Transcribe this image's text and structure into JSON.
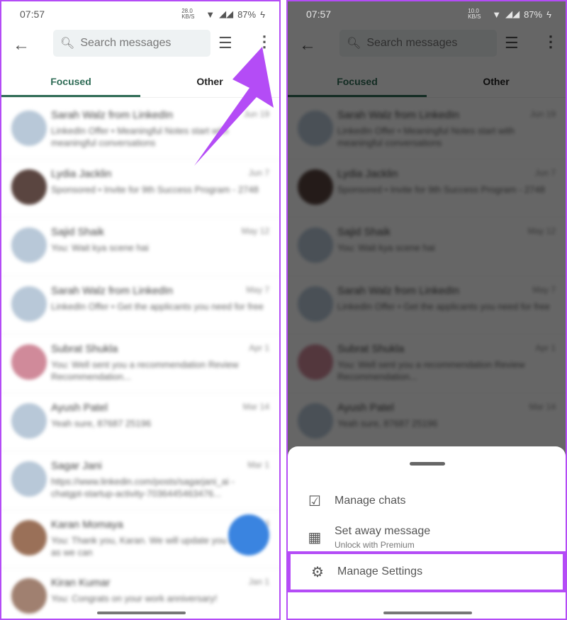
{
  "status": {
    "time": "07:57",
    "left_speed": "28.0 KB/S",
    "right_speed": "10.0 KB/S",
    "battery": "87%"
  },
  "header": {
    "search_placeholder": "Search messages",
    "back_icon": "arrow-left-icon",
    "filter_icon": "sliders-icon",
    "more_icon": "more-vertical-icon"
  },
  "tabs": [
    {
      "label": "Focused",
      "active": true
    },
    {
      "label": "Other",
      "active": false
    }
  ],
  "conversations": [
    {
      "name": "Sarah Walz from LinkedIn",
      "date": "Jun 19",
      "preview": "LinkedIn Offer • Meaningful Notes start with meaningful conversations",
      "avatar": "#b8c8d8"
    },
    {
      "name": "Lydia Jacklin",
      "date": "Jun 7",
      "preview": "Sponsored • Invite for 9th Success Program - 2748",
      "avatar": "#5a4540"
    },
    {
      "name": "Sajid Shaik",
      "date": "May 12",
      "preview": "You: Wait kya scene hai",
      "avatar": "#b8c8d8"
    },
    {
      "name": "Sarah Walz from LinkedIn",
      "date": "May 7",
      "preview": "LinkedIn Offer • Get the applicants you need for free",
      "avatar": "#b8c8d8"
    },
    {
      "name": "Subrat Shukla",
      "date": "Apr 1",
      "preview": "You: Well sent you a recommendation Review Recommendation...",
      "avatar": "#d08a9a"
    },
    {
      "name": "Ayush Patel",
      "date": "Mar 14",
      "preview": "Yeah sure, 87687 25196",
      "avatar": "#b8c8d8"
    },
    {
      "name": "Sagar Jani",
      "date": "Mar 1",
      "preview": "https://www.linkedin.com/posts/sagarjani_ai -chatgpt-startup-activity-7036445463476...",
      "avatar": "#b8c8d8"
    },
    {
      "name": "Karan Momaya",
      "date": "Feb 3",
      "preview": "You: Thank you, Karan. We will update you as soon as we can",
      "avatar": "#9a7058"
    },
    {
      "name": "Kiran Kumar",
      "date": "Jan 1",
      "preview": "You: Congrats on your work anniversary!",
      "avatar": "#a08070"
    }
  ],
  "sheet": {
    "items": [
      {
        "label": "Manage chats",
        "icon": "checklist-icon"
      },
      {
        "label": "Set away message",
        "sub": "Unlock with Premium",
        "icon": "calendar-icon"
      },
      {
        "label": "Manage Settings",
        "icon": "gear-icon"
      }
    ]
  },
  "colors": {
    "highlight": "#b44cf6",
    "accent": "#2e6b55",
    "fab": "#3a84e0"
  }
}
